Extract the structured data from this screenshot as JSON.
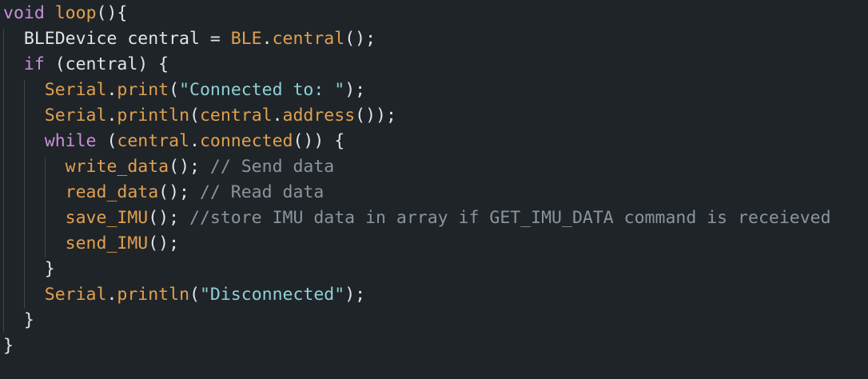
{
  "editor": {
    "lines": [
      [
        {
          "cls": "kw",
          "text": "void"
        },
        {
          "cls": "pl",
          "text": " "
        },
        {
          "cls": "fn",
          "text": "loop"
        },
        {
          "cls": "pl",
          "text": "(){"
        }
      ],
      [
        {
          "cls": "pl",
          "text": "  BLEDevice central = "
        },
        {
          "cls": "fn",
          "text": "BLE"
        },
        {
          "cls": "pl",
          "text": "."
        },
        {
          "cls": "fn",
          "text": "central"
        },
        {
          "cls": "pl",
          "text": "();"
        }
      ],
      [
        {
          "cls": "pl",
          "text": "  "
        },
        {
          "cls": "kw",
          "text": "if"
        },
        {
          "cls": "pl",
          "text": " (central) {"
        }
      ],
      [
        {
          "cls": "pl",
          "text": "    "
        },
        {
          "cls": "fn",
          "text": "Serial"
        },
        {
          "cls": "pl",
          "text": "."
        },
        {
          "cls": "fn",
          "text": "print"
        },
        {
          "cls": "pl",
          "text": "("
        },
        {
          "cls": "str",
          "text": "\"Connected to: \""
        },
        {
          "cls": "pl",
          "text": ");"
        }
      ],
      [
        {
          "cls": "pl",
          "text": "    "
        },
        {
          "cls": "fn",
          "text": "Serial"
        },
        {
          "cls": "pl",
          "text": "."
        },
        {
          "cls": "fn",
          "text": "println"
        },
        {
          "cls": "pl",
          "text": "("
        },
        {
          "cls": "fn",
          "text": "central"
        },
        {
          "cls": "pl",
          "text": "."
        },
        {
          "cls": "fn",
          "text": "address"
        },
        {
          "cls": "pl",
          "text": "());"
        }
      ],
      [
        {
          "cls": "pl",
          "text": "    "
        },
        {
          "cls": "kw",
          "text": "while"
        },
        {
          "cls": "pl",
          "text": " ("
        },
        {
          "cls": "fn",
          "text": "central"
        },
        {
          "cls": "pl",
          "text": "."
        },
        {
          "cls": "fn",
          "text": "connected"
        },
        {
          "cls": "pl",
          "text": "()) {"
        }
      ],
      [
        {
          "cls": "pl",
          "text": "      "
        },
        {
          "cls": "fn",
          "text": "write_data"
        },
        {
          "cls": "pl",
          "text": "(); "
        },
        {
          "cls": "cm",
          "text": "// Send data"
        }
      ],
      [
        {
          "cls": "pl",
          "text": "      "
        },
        {
          "cls": "fn",
          "text": "read_data"
        },
        {
          "cls": "pl",
          "text": "(); "
        },
        {
          "cls": "cm",
          "text": "// Read data"
        }
      ],
      [
        {
          "cls": "pl",
          "text": "      "
        },
        {
          "cls": "fn",
          "text": "save_IMU"
        },
        {
          "cls": "pl",
          "text": "(); "
        },
        {
          "cls": "cm",
          "text": "//store IMU data in array if GET_IMU_DATA command is receieved"
        }
      ],
      [
        {
          "cls": "pl",
          "text": "      "
        },
        {
          "cls": "fn",
          "text": "send_IMU"
        },
        {
          "cls": "pl",
          "text": "();"
        }
      ],
      [
        {
          "cls": "pl",
          "text": "    }"
        }
      ],
      [
        {
          "cls": "pl",
          "text": "    "
        },
        {
          "cls": "fn",
          "text": "Serial"
        },
        {
          "cls": "pl",
          "text": "."
        },
        {
          "cls": "fn",
          "text": "println"
        },
        {
          "cls": "pl",
          "text": "("
        },
        {
          "cls": "str",
          "text": "\"Disconnected\""
        },
        {
          "cls": "pl",
          "text": ");"
        }
      ],
      [
        {
          "cls": "pl",
          "text": "  }"
        }
      ],
      [
        {
          "cls": "pl",
          "text": "}"
        }
      ]
    ]
  },
  "colors": {
    "background": "#1f2428",
    "keyword": "#c98fd8",
    "function": "#e0a050",
    "string": "#8fd0d6",
    "comment": "#8b949e",
    "plain": "#e1e4e8",
    "indent_guide": "#3f444a"
  }
}
